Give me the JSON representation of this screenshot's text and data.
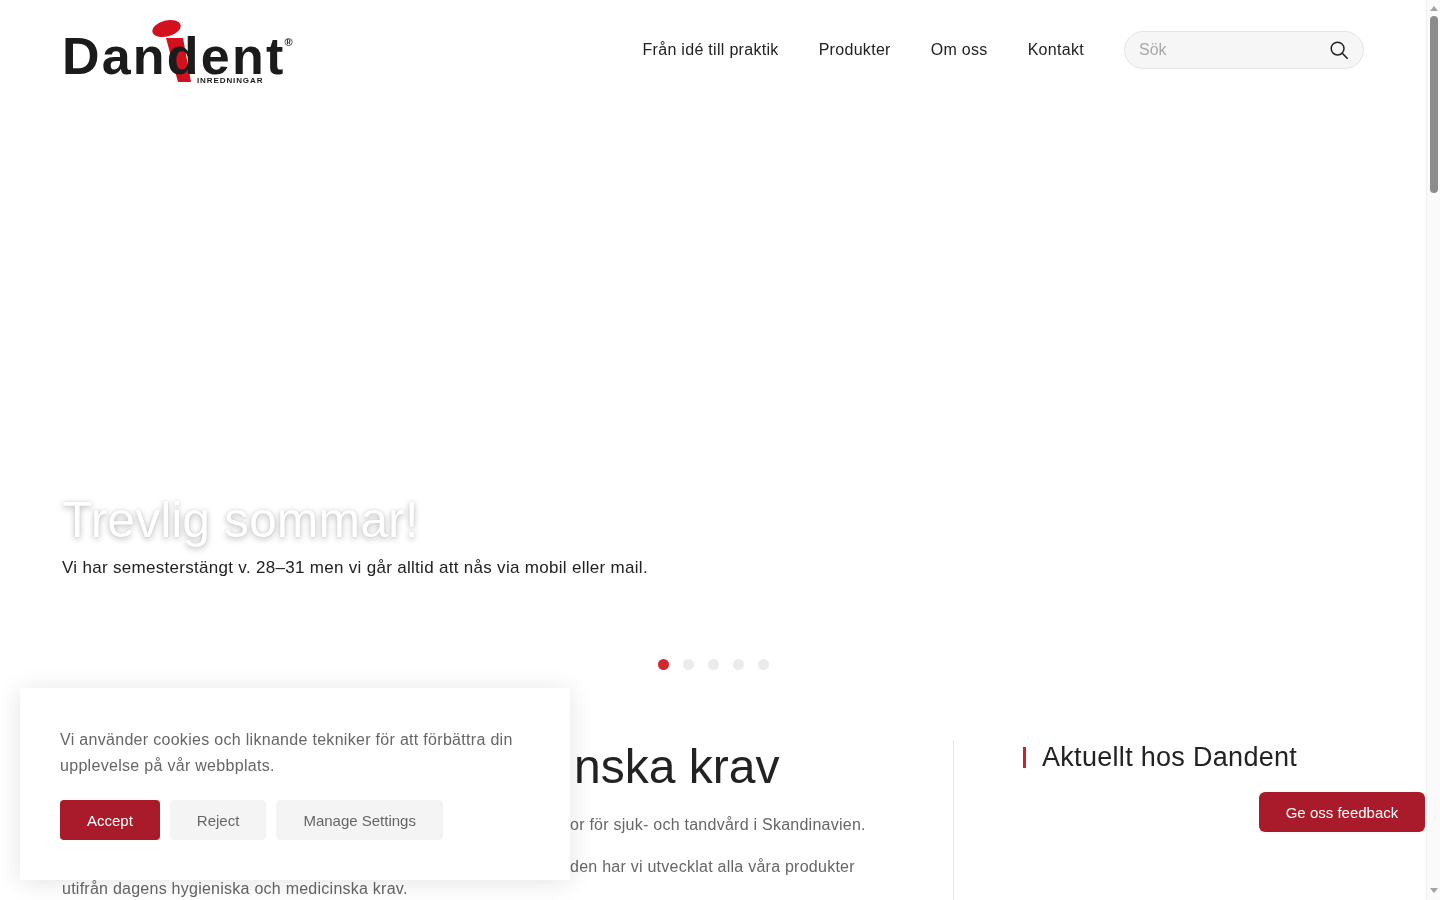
{
  "header": {
    "logo": {
      "wordmark": "Dandent",
      "registered": "®",
      "tagline": "INREDNINGAR"
    },
    "nav": [
      {
        "label": "Från idé till praktik"
      },
      {
        "label": "Produkter"
      },
      {
        "label": "Om oss"
      },
      {
        "label": "Kontakt"
      }
    ],
    "search": {
      "placeholder": "Sök"
    }
  },
  "hero": {
    "title": "Trevlig sommar!",
    "subtitle": "Vi har semesterstängt v. 28–31 men vi går alltid att nås via mobil eller mail.",
    "dots": [
      {
        "selected": true
      },
      {
        "selected": false
      },
      {
        "selected": false
      },
      {
        "selected": false
      },
      {
        "selected": false
      }
    ]
  },
  "intro": {
    "heading": "nska krav",
    "paragraphs": [
      {
        "lines": [
          {
            "text": "or för sjuk- och tandvård i Skandinavien.",
            "covered": true
          }
        ]
      },
      {
        "lines": [
          {
            "text": "den har vi utvecklat alla våra produkter",
            "covered": true
          },
          {
            "text": "utifrån dagens hygieniska och medicinska krav.",
            "covered": false
          }
        ]
      }
    ]
  },
  "news": {
    "heading": "Aktuellt hos Dandent"
  },
  "cookie_banner": {
    "text": "Vi använder cookies och liknande tekniker för att förbättra din upplevelse på vår webbplats.",
    "buttons": [
      {
        "label": "Accept",
        "kind": "primary"
      },
      {
        "label": "Reject",
        "kind": "secondary"
      },
      {
        "label": "Manage Settings",
        "kind": "secondary"
      }
    ]
  },
  "feedback_button": {
    "label": "Ge oss feedback"
  }
}
